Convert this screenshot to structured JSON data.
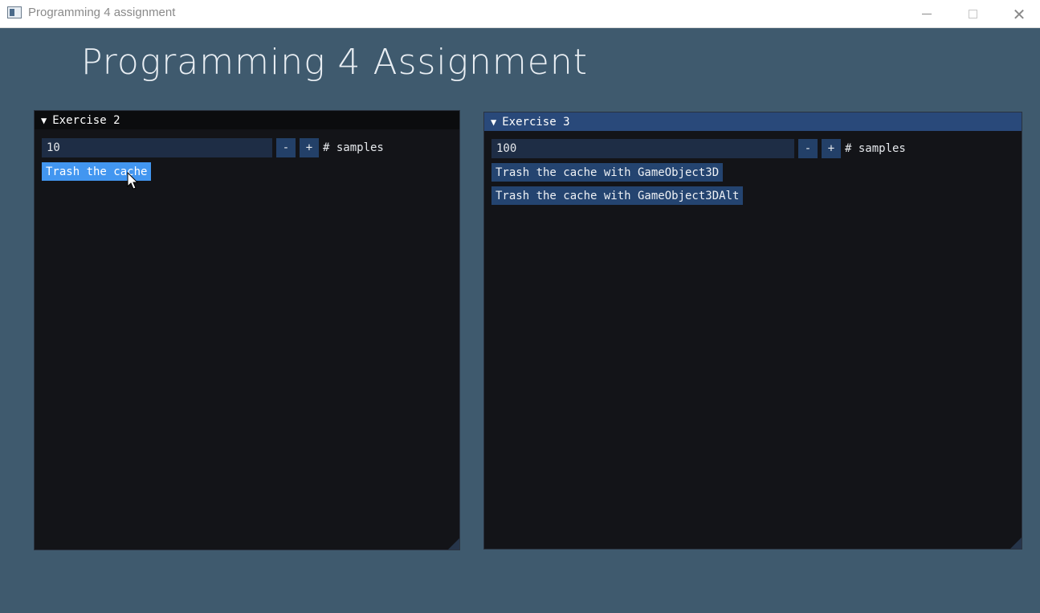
{
  "window": {
    "title": "Programming 4 assignment",
    "controls": {
      "minimize": "minimize-icon",
      "maximize": "maximize-icon",
      "close": "close-icon"
    }
  },
  "app": {
    "heading": "Programming 4 Assignment"
  },
  "exercise2": {
    "header": "Exercise 2",
    "samples_value": "10",
    "minus": "-",
    "plus": "+",
    "samples_label": "# samples",
    "button": "Trash the cache"
  },
  "exercise3": {
    "header": "Exercise 3",
    "samples_value": "100",
    "minus": "-",
    "plus": "+",
    "samples_label": "# samples",
    "button_3d": "Trash the cache with GameObject3D",
    "button_3dalt": "Trash the cache with GameObject3DAlt"
  },
  "colors": {
    "background": "#3f5a6e",
    "panel": "#131418",
    "active_header": "#29497a",
    "button": "#244470",
    "button_hover": "#4296f0"
  }
}
